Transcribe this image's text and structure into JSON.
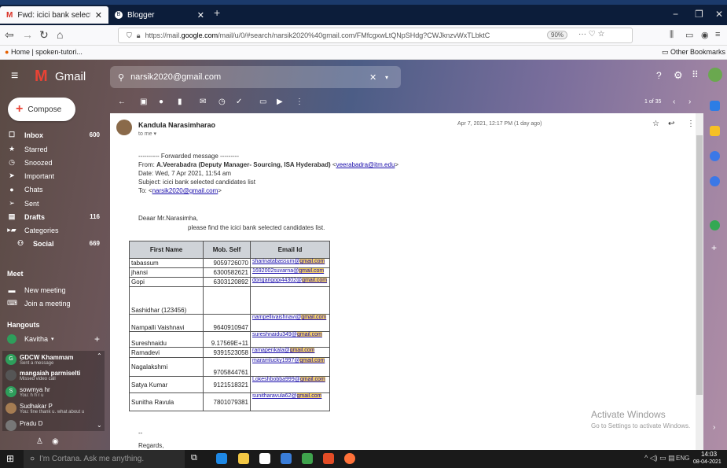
{
  "browser": {
    "tabs": [
      {
        "label": "Fwd: icici bank selected candid"
      },
      {
        "label": "Blogger"
      }
    ],
    "url_prefix": "https://mail.",
    "url_host": "google.com",
    "url_rest": "/mail/u/0/#search/narsik2020%40gmail.com/FMfcgxwLtQNpSHdg?CWJknzvWxTLbktC",
    "zoom": "90%",
    "bookmark_home": "Home | spoken-tutori...",
    "bookmark_other": "Other Bookmarks"
  },
  "gmail": {
    "logo_text": "Gmail",
    "search_query": "narsik2020@gmail.com",
    "compose_label": "Compose",
    "nav": [
      {
        "label": "Inbox",
        "count": "600",
        "bold": true
      },
      {
        "label": "Starred",
        "count": ""
      },
      {
        "label": "Snoozed",
        "count": ""
      },
      {
        "label": "Important",
        "count": ""
      },
      {
        "label": "Chats",
        "count": ""
      },
      {
        "label": "Sent",
        "count": ""
      },
      {
        "label": "Drafts",
        "count": "116",
        "bold": true
      },
      {
        "label": "Categories",
        "count": ""
      },
      {
        "label": "Social",
        "count": "669",
        "bold": true
      }
    ],
    "meet_heading": "Meet",
    "meet_items": [
      "New meeting",
      "Join a meeting"
    ],
    "hangouts_heading": "Hangouts",
    "hangouts_user": "Kavitha",
    "hangouts": [
      {
        "name": "GDCW Khammam",
        "sub": "Sent a message"
      },
      {
        "name": "mangaiah parmiselti",
        "sub": "Missed video call"
      },
      {
        "name": "sowmya hr",
        "sub": "You: h h r u"
      },
      {
        "name": "Sudhakar P",
        "sub": "You: fine thank u. what about u"
      },
      {
        "name": "Pradu D",
        "sub": ""
      }
    ],
    "pager": "1 of 35"
  },
  "email": {
    "sender": "Kandula Narasimharao",
    "to": "to me",
    "datetime": "Apr 7, 2021, 12:17 PM (1 day ago)",
    "fwd_header": "---------- Forwarded message ---------",
    "from_label": "From: ",
    "from_name": "A.Veerabadra (Deputy Manager- Sourcing, ISA Hyderabad)",
    "from_email": "veerabadra@itm.edu",
    "date_line": "Date: Wed, 7 Apr 2021, 11:54 am",
    "subject_line": "Subject: icici bank selected candidates list",
    "to_label": "To: ",
    "to_email": "narsik2020@gmail.com",
    "greeting": "Deaar Mr.Narasimha,",
    "body": "please find the icici bank selected candidates list.",
    "table_headers": [
      "First Name",
      "Mob. Self",
      "Email Id"
    ],
    "rows": [
      {
        "name": "tabassum",
        "mob": "9059726070",
        "email_user": "sharinatabassum@",
        "email_domain": "gmail.com"
      },
      {
        "name": "jhansi",
        "mob": "6300582621",
        "email_user": "1692002suvarna@",
        "email_domain": "gmail.com"
      },
      {
        "name": "Gopi",
        "mob": "6303120892",
        "email_user": "dongarigopi44302@",
        "email_domain": "gmail.com"
      },
      {
        "name": "Sashidhar (123456)",
        "mob": "",
        "email_user": "",
        "email_domain": ""
      },
      {
        "name": "Nampalli Vaishnavi",
        "mob": "9640910947",
        "email_user": "nampellivaishnavi@",
        "email_domain": "gmail.com"
      },
      {
        "name": "Sureshnaidu",
        "mob": "9.17569E+11",
        "email_user": "sureshnaidu349@",
        "email_domain": "gmail.com"
      },
      {
        "name": "Ramadevi",
        "mob": "9391523058",
        "email_user": "ramapenkala@",
        "email_domain": "gmail.com"
      },
      {
        "name": "Nagalakshmi",
        "mob": "9705844761",
        "email_user": "maramlucky1997@",
        "email_domain": "gmail.com"
      },
      {
        "name": "Satya Kumar",
        "mob": "9121518321",
        "email_user": "Lokeshbobba999@",
        "email_domain": "gmail.com"
      },
      {
        "name": "Sunitha Ravula",
        "mob": "7801079381",
        "email_user": "sunitharavula62@",
        "email_domain": "gmail.com"
      }
    ],
    "ellipsis": "--",
    "regards": "Regards,"
  },
  "watermark": {
    "title": "Activate Windows",
    "sub": "Go to Settings to activate Windows."
  },
  "taskbar": {
    "cortana": "I'm Cortana. Ask me anything.",
    "lang": "ENG",
    "time": "14:03",
    "date": "08-04-2021"
  }
}
